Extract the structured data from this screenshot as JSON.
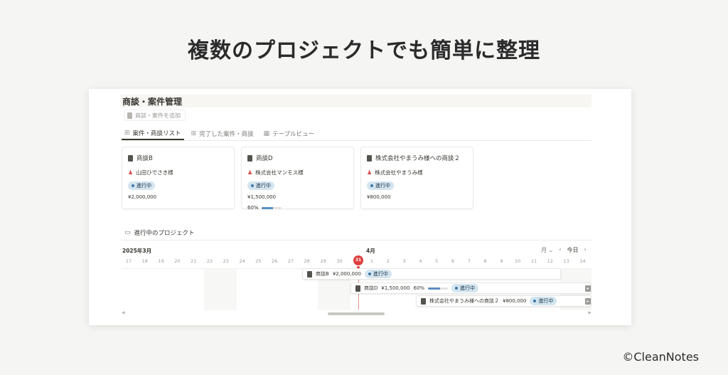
{
  "headline": "複数のプロジェクトでも簡単に整理",
  "copyright": "©CleanNotes",
  "page": {
    "title": "商談・案件管理",
    "add_button": "商談・案件を追加",
    "tabs": [
      "案件・商談リスト",
      "完了した案件・商談",
      "テーブルビュー"
    ]
  },
  "cards": [
    {
      "title": "商談B",
      "person": "山田ひでさき様",
      "status": "進行中",
      "amount": "¥2,000,000",
      "progress_label": "",
      "progress": null
    },
    {
      "title": "商談D",
      "person": "株式会社マンモス様",
      "status": "進行中",
      "amount": "¥1,500,000",
      "progress_label": "60%",
      "progress": 0.6
    },
    {
      "title": "株式会社やまうみ様への商談２",
      "person": "株式会社やまうみ様",
      "status": "進行中",
      "amount": "¥800,000",
      "progress_label": "",
      "progress": null
    }
  ],
  "timeline": {
    "title": "進行中のプロジェクト",
    "month_left": "2025年3月",
    "month_right": "4月",
    "view": "月",
    "today_button": "今日",
    "today_marker": "31",
    "days": [
      "17",
      "18",
      "19",
      "20",
      "21",
      "22",
      "23",
      "24",
      "25",
      "26",
      "27",
      "28",
      "29",
      "30",
      "",
      "1",
      "2",
      "3",
      "4",
      "5",
      "6",
      "7",
      "8",
      "9",
      "10",
      "11",
      "12",
      "13",
      "14"
    ],
    "bars": [
      {
        "title": "商談B",
        "amount": "¥2,000,000",
        "status": "進行中"
      },
      {
        "title": "商談D",
        "amount": "¥1,500,000",
        "progress_label": "60%",
        "progress": 0.6,
        "status": "進行中"
      },
      {
        "title": "株式会社やまうみ様への商談２",
        "amount": "¥800,000",
        "status": "進行中"
      }
    ]
  },
  "colors": {
    "status_badge_bg": "#d3e5ef",
    "today_red": "#e03e3e",
    "progress_blue": "#5a8ec0"
  }
}
